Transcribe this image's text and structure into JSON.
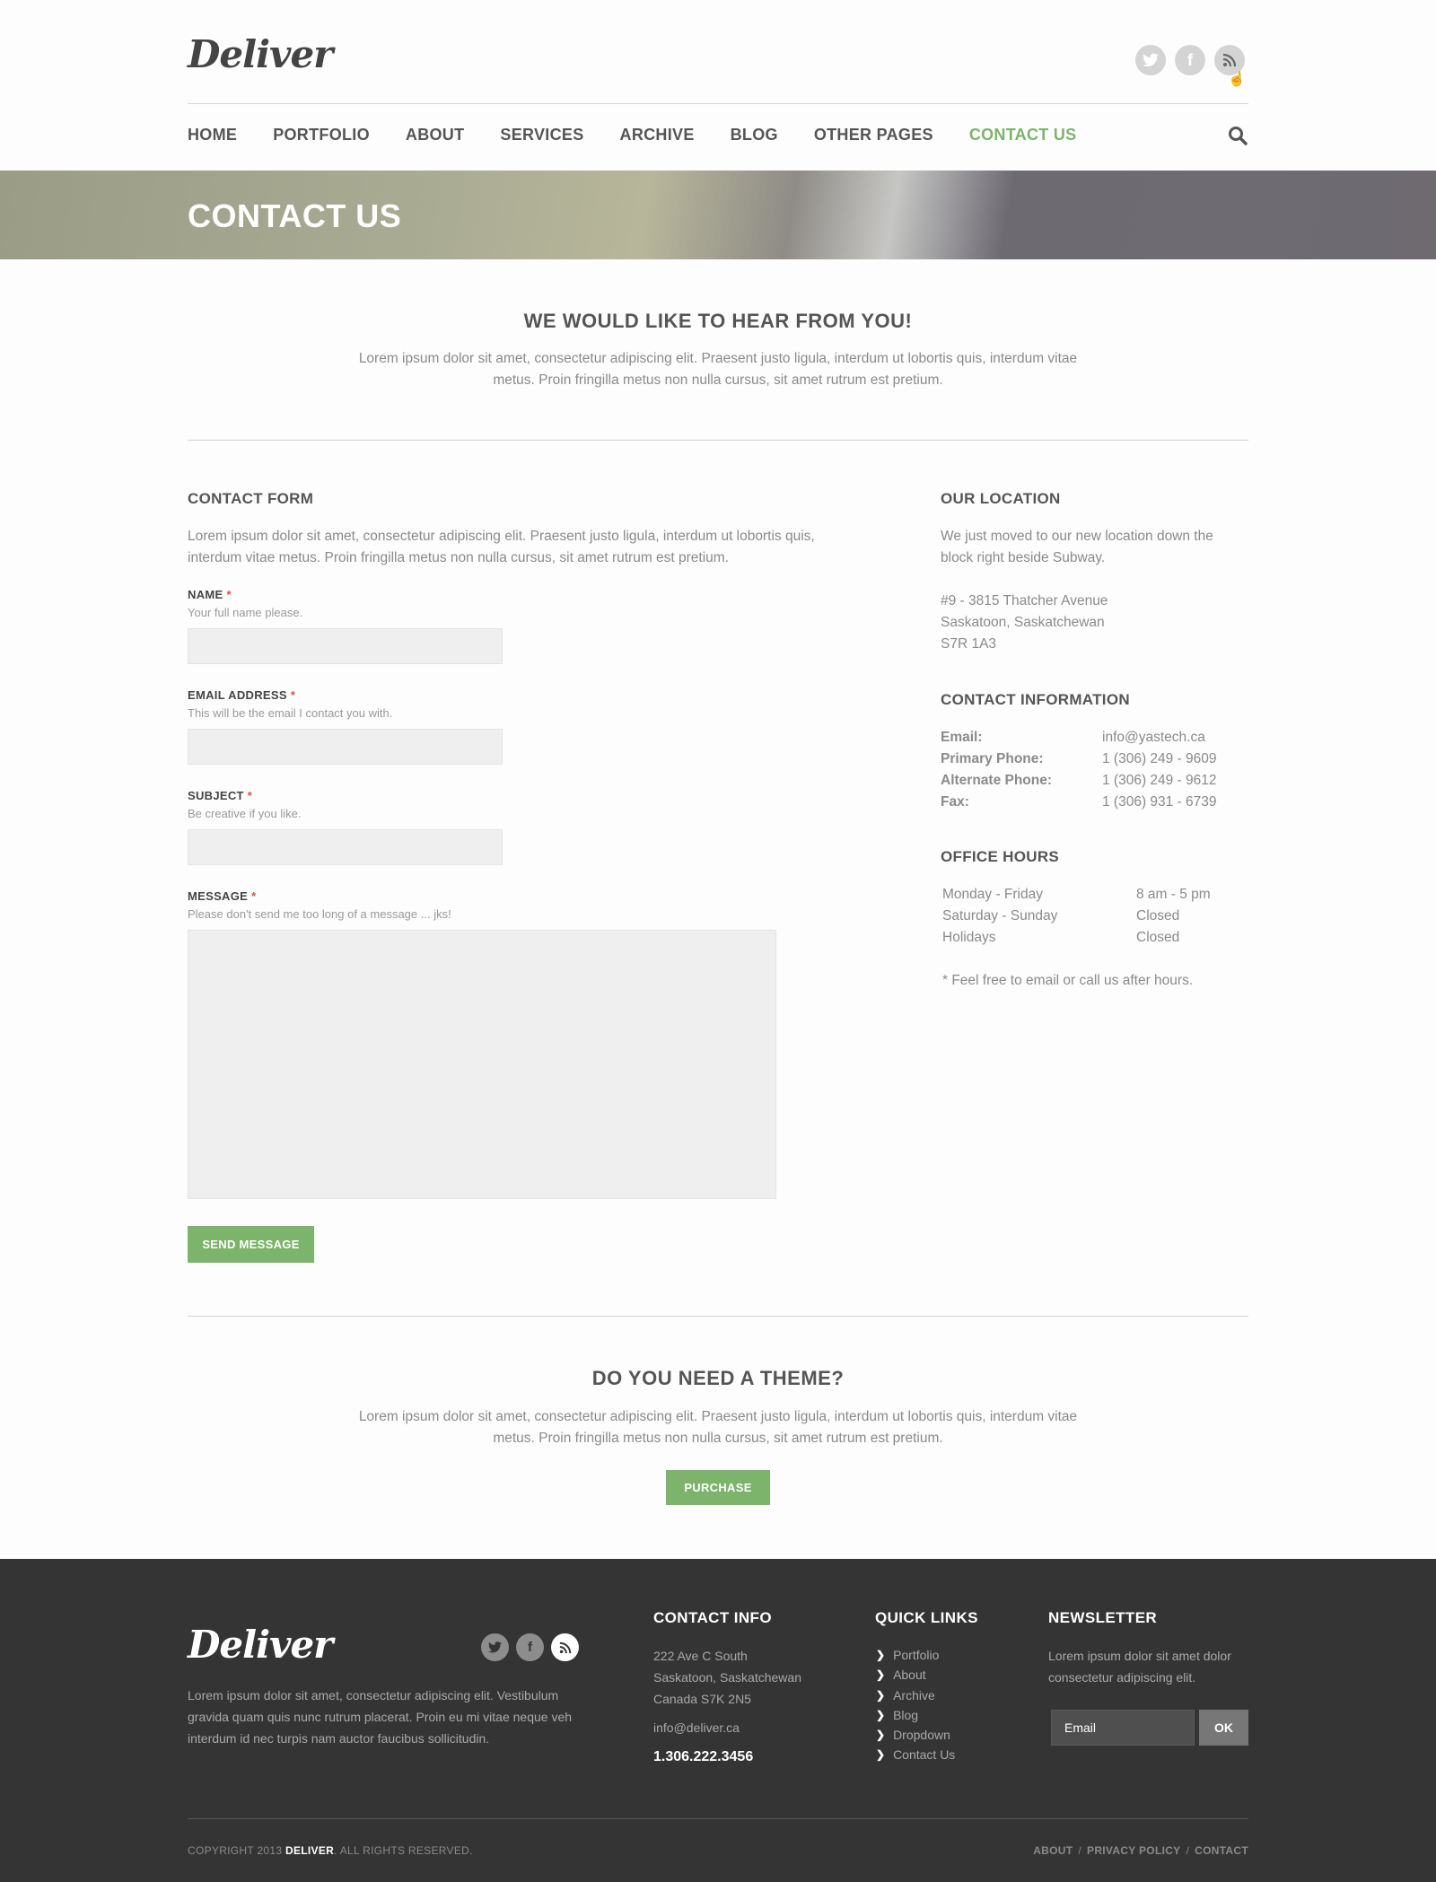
{
  "header": {
    "logo": "Deliver",
    "social": [
      "twitter-icon",
      "facebook-icon",
      "rss-icon"
    ],
    "nav": [
      "HOME",
      "PORTFOLIO",
      "ABOUT",
      "SERVICES",
      "ARCHIVE",
      "BLOG",
      "OTHER PAGES",
      "CONTACT US"
    ],
    "active_nav": "CONTACT US",
    "accent_color": "#7cb46c"
  },
  "banner": {
    "title": "CONTACT US"
  },
  "intro": {
    "title": "WE WOULD LIKE TO HEAR FROM YOU!",
    "text_line1": "Lorem ipsum dolor sit amet, consectetur adipiscing elit. Praesent justo ligula, interdum ut lobortis quis, interdum vitae",
    "text_line2": "metus. Proin fringilla metus non nulla cursus, sit amet rutrum est pretium."
  },
  "form": {
    "title": "CONTACT FORM",
    "text_line1": "Lorem ipsum dolor sit amet, consectetur adipiscing elit. Praesent justo ligula, interdum ut lobortis quis,",
    "text_line2": "interdum vitae metus. Proin fringilla metus non nulla cursus, sit amet rutrum est pretium.",
    "fields": [
      {
        "label": "NAME",
        "required": "*",
        "hint": "Your full name please.",
        "value": ""
      },
      {
        "label": "EMAIL ADDRESS",
        "required": "*",
        "hint": "This will be the email I contact you with.",
        "value": ""
      },
      {
        "label": "SUBJECT",
        "required": "*",
        "hint": "Be creative if you like.",
        "value": ""
      },
      {
        "label": "MESSAGE",
        "required": "*",
        "hint": "Please don't send me too long of a message ... jks!",
        "value": ""
      }
    ],
    "submit": "SEND MESSAGE"
  },
  "location": {
    "title": "OUR LOCATION",
    "text_line1": "We just moved to our new location down the",
    "text_line2": "block right beside Subway.",
    "address": [
      "#9 - 3815 Thatcher Avenue",
      "Saskatoon, Saskatchewan",
      "S7R 1A3"
    ]
  },
  "contact_info": {
    "title": "CONTACT INFORMATION",
    "rows": [
      {
        "key": "Email:",
        "value": "info@yastech.ca"
      },
      {
        "key": "Primary Phone:",
        "value": "1 (306) 249 - 9609"
      },
      {
        "key": "Alternate Phone:",
        "value": "1 (306) 249 - 9612"
      },
      {
        "key": "Fax:",
        "value": "1 (306) 931 - 6739"
      }
    ]
  },
  "office_hours": {
    "title": "OFFICE HOURS",
    "rows": [
      {
        "day": "Monday - Friday",
        "hours": "8 am - 5 pm"
      },
      {
        "day": "Saturday - Sunday",
        "hours": "Closed"
      },
      {
        "day": "Holidays",
        "hours": "Closed"
      }
    ],
    "note": "* Feel free to email or call us after hours."
  },
  "theme": {
    "title": "DO YOU NEED A THEME?",
    "text_line1": "Lorem ipsum dolor sit amet, consectetur adipiscing elit. Praesent justo ligula, interdum ut lobortis quis, interdum vitae",
    "text_line2": "metus. Proin fringilla metus non nulla cursus, sit amet rutrum est pretium.",
    "button": "PURCHASE"
  },
  "footer": {
    "logo": "Deliver",
    "about_line1": "Lorem ipsum dolor sit amet, consectetur adipiscing elit. Vestibulum",
    "about_line2": "gravida quam quis nunc rutrum placerat. Proin eu mi vitae neque veh",
    "about_line3": "interdum id nec turpis nam auctor faucibus sollicitudin.",
    "contact_title": "CONTACT INFO",
    "contact_address": [
      "222 Ave C South",
      "Saskatoon, Saskatchewan",
      "Canada S7K 2N5"
    ],
    "contact_email": "info@deliver.ca",
    "contact_phone": "1.306.222.3456",
    "links_title": "QUICK LINKS",
    "links": [
      "Portfolio",
      "About",
      "Archive",
      "Blog",
      "Dropdown",
      "Contact Us"
    ],
    "newsletter_title": "NEWSLETTER",
    "newsletter_line1": "Lorem ipsum dolor sit amet dolor",
    "newsletter_line2": "consectetur adipiscing elit.",
    "email_placeholder": "Email",
    "ok": "OK",
    "copyright_pre": "COPYRIGHT 2013 ",
    "copyright_brand": "DELIVER",
    "copyright_post": ". ALL RIGHTS RESERVED.",
    "bottom_links": [
      "ABOUT",
      "PRIVACY POLICY",
      "CONTACT"
    ],
    "separator": "/"
  }
}
